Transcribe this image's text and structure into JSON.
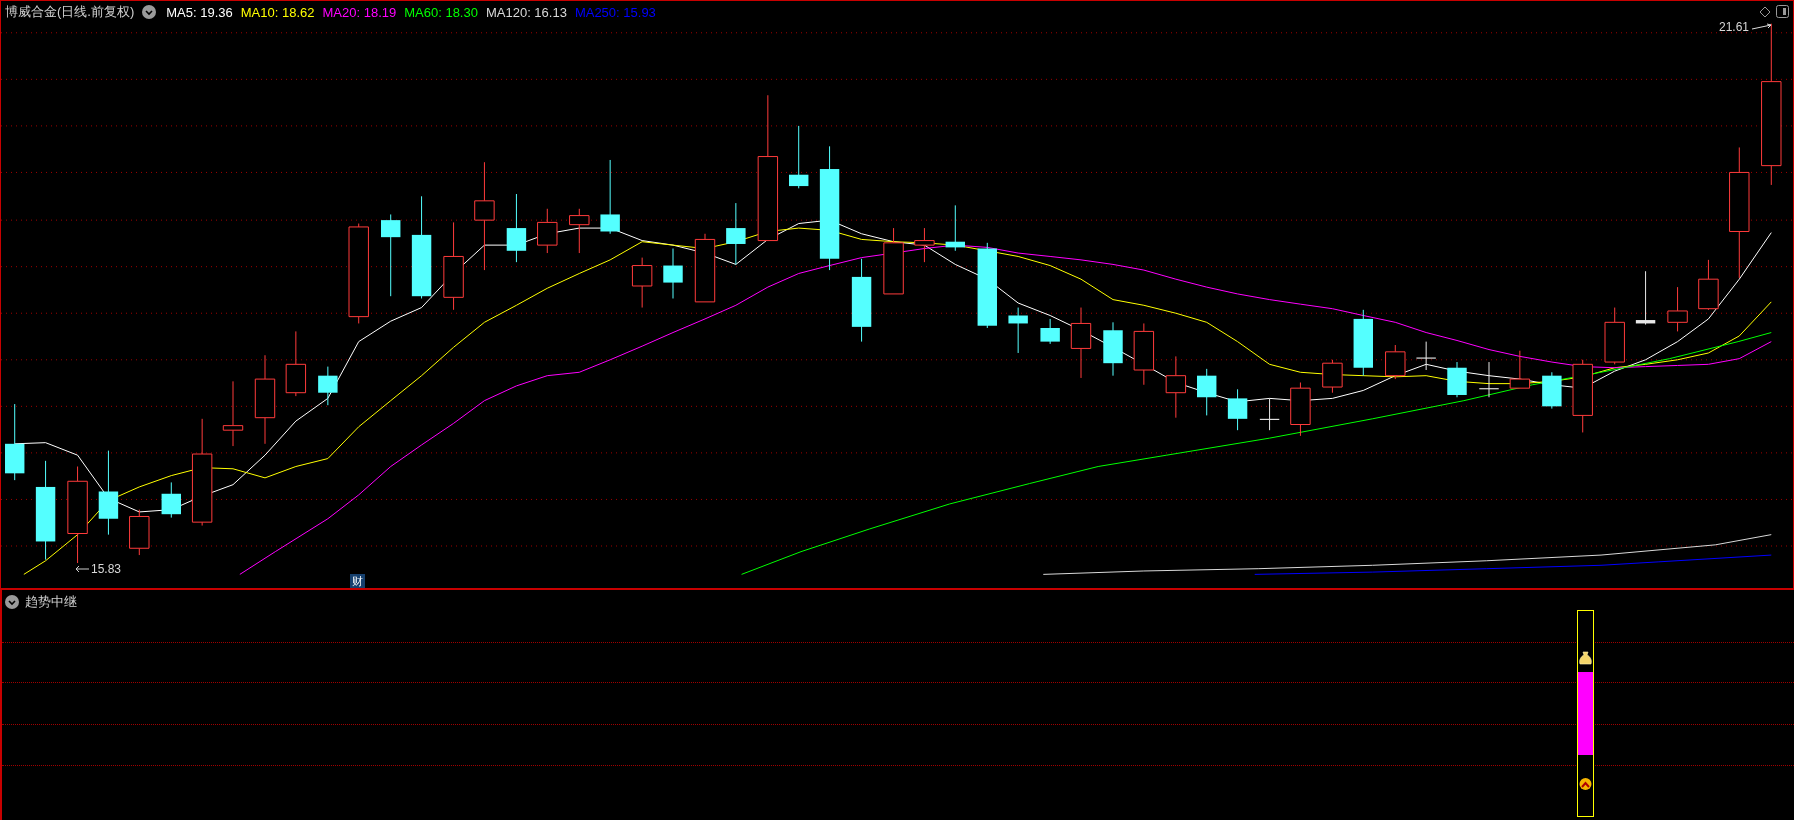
{
  "title": "博威合金(日线.前复权)",
  "ma_legend": [
    {
      "label": "MA5: 19.36",
      "color": "#ffffff"
    },
    {
      "label": "MA10: 18.62",
      "color": "#ffff00"
    },
    {
      "label": "MA20: 18.19",
      "color": "#ff00ff"
    },
    {
      "label": "MA60: 18.30",
      "color": "#00ff00"
    },
    {
      "label": "MA120: 16.13",
      "color": "#d8d8d8"
    },
    {
      "label": "MA250: 15.93",
      "color": "#0000ff"
    }
  ],
  "chart_labels": {
    "high": "21.61",
    "low": "15.83",
    "badge": "财"
  },
  "sub_panel": {
    "title": "趋势中继"
  }
}
